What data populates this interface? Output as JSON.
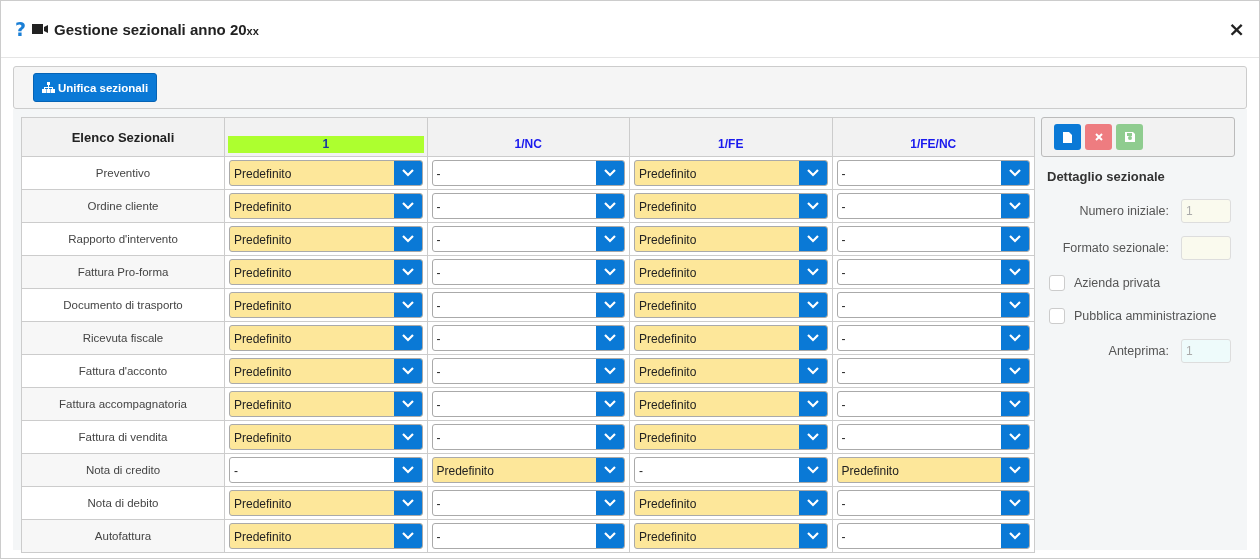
{
  "window": {
    "title": "Gestione sezionali anno 20",
    "title_suffix": "xx",
    "close": "×",
    "help": "?"
  },
  "toolbar": {
    "button": "Unifica sezionali"
  },
  "table": {
    "corner": "Elenco Sezionali",
    "columns": [
      {
        "label": "1",
        "selected": true
      },
      {
        "label": "1/NC",
        "selected": false
      },
      {
        "label": "1/FE",
        "selected": false
      },
      {
        "label": "1/FE/NC",
        "selected": false
      }
    ],
    "rows": [
      {
        "label": "Preventivo",
        "cells": [
          {
            "value": "Predefinito",
            "highlighted": true
          },
          {
            "value": "-",
            "highlighted": false
          },
          {
            "value": "Predefinito",
            "highlighted": true
          },
          {
            "value": "-",
            "highlighted": false
          }
        ]
      },
      {
        "label": "Ordine cliente",
        "cells": [
          {
            "value": "Predefinito",
            "highlighted": true
          },
          {
            "value": "-",
            "highlighted": false
          },
          {
            "value": "Predefinito",
            "highlighted": true
          },
          {
            "value": "-",
            "highlighted": false
          }
        ]
      },
      {
        "label": "Rapporto d'intervento",
        "cells": [
          {
            "value": "Predefinito",
            "highlighted": true
          },
          {
            "value": "-",
            "highlighted": false
          },
          {
            "value": "Predefinito",
            "highlighted": true
          },
          {
            "value": "-",
            "highlighted": false
          }
        ]
      },
      {
        "label": "Fattura Pro-forma",
        "cells": [
          {
            "value": "Predefinito",
            "highlighted": true
          },
          {
            "value": "-",
            "highlighted": false
          },
          {
            "value": "Predefinito",
            "highlighted": true
          },
          {
            "value": "-",
            "highlighted": false
          }
        ]
      },
      {
        "label": "Documento di trasporto",
        "cells": [
          {
            "value": "Predefinito",
            "highlighted": true
          },
          {
            "value": "-",
            "highlighted": false
          },
          {
            "value": "Predefinito",
            "highlighted": true
          },
          {
            "value": "-",
            "highlighted": false
          }
        ]
      },
      {
        "label": "Ricevuta fiscale",
        "cells": [
          {
            "value": "Predefinito",
            "highlighted": true
          },
          {
            "value": "-",
            "highlighted": false
          },
          {
            "value": "Predefinito",
            "highlighted": true
          },
          {
            "value": "-",
            "highlighted": false
          }
        ]
      },
      {
        "label": "Fattura d'acconto",
        "cells": [
          {
            "value": "Predefinito",
            "highlighted": true
          },
          {
            "value": "-",
            "highlighted": false
          },
          {
            "value": "Predefinito",
            "highlighted": true
          },
          {
            "value": "-",
            "highlighted": false
          }
        ]
      },
      {
        "label": "Fattura accompagnatoria",
        "cells": [
          {
            "value": "Predefinito",
            "highlighted": true
          },
          {
            "value": "-",
            "highlighted": false
          },
          {
            "value": "Predefinito",
            "highlighted": true
          },
          {
            "value": "-",
            "highlighted": false
          }
        ]
      },
      {
        "label": "Fattura di vendita",
        "cells": [
          {
            "value": "Predefinito",
            "highlighted": true
          },
          {
            "value": "-",
            "highlighted": false
          },
          {
            "value": "Predefinito",
            "highlighted": true
          },
          {
            "value": "-",
            "highlighted": false
          }
        ]
      },
      {
        "label": "Nota di credito",
        "cells": [
          {
            "value": "-",
            "highlighted": false
          },
          {
            "value": "Predefinito",
            "highlighted": true
          },
          {
            "value": "-",
            "highlighted": false
          },
          {
            "value": "Predefinito",
            "highlighted": true
          }
        ]
      },
      {
        "label": "Nota di debito",
        "cells": [
          {
            "value": "Predefinito",
            "highlighted": true
          },
          {
            "value": "-",
            "highlighted": false
          },
          {
            "value": "Predefinito",
            "highlighted": true
          },
          {
            "value": "-",
            "highlighted": false
          }
        ]
      },
      {
        "label": "Autofattura",
        "cells": [
          {
            "value": "Predefinito",
            "highlighted": true
          },
          {
            "value": "-",
            "highlighted": false
          },
          {
            "value": "Predefinito",
            "highlighted": true
          },
          {
            "value": "-",
            "highlighted": false
          }
        ]
      }
    ]
  },
  "detail": {
    "title": "Dettaglio sezionale",
    "fields": [
      {
        "kind": "input",
        "label": "Numero iniziale:",
        "value": "1",
        "disabled": true
      },
      {
        "kind": "input",
        "label": "Formato sezionale:",
        "disabled": true
      },
      {
        "kind": "checkbox",
        "label": "Azienda privata",
        "checked": false
      },
      {
        "kind": "checkbox",
        "label": "Pubblica amministrazione",
        "checked": false
      },
      {
        "kind": "preview",
        "label": "Anteprima:",
        "value": "1",
        "disabled": true
      }
    ]
  }
}
